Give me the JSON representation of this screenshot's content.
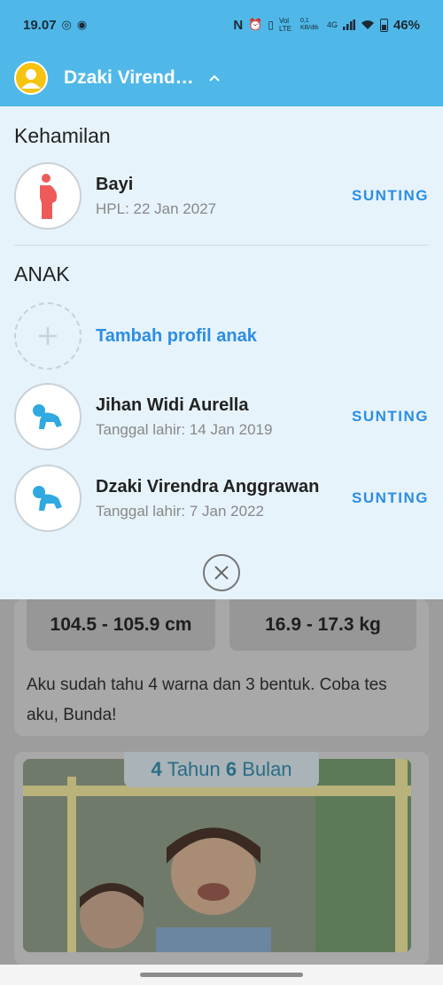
{
  "status_bar": {
    "time": "19.07",
    "network": "Vol LTE",
    "speed": "0,1 KB/dtk",
    "signal": "4G",
    "battery": "46%"
  },
  "header": {
    "child_name": "Dzaki Virend…"
  },
  "pregnancy": {
    "section_title": "Kehamilan",
    "name": "Bayi",
    "due_date": "HPL: 22 Jan 2027",
    "edit_label": "SUNTING"
  },
  "children": {
    "section_title": "ANAK",
    "add_label": "Tambah profil anak",
    "items": [
      {
        "name": "Jihan Widi Aurella",
        "birth": "Tanggal lahir: 14 Jan 2019",
        "edit_label": "SUNTING"
      },
      {
        "name": "Dzaki Virendra Anggrawan",
        "birth": "Tanggal lahir: 7 Jan 2022",
        "edit_label": "SUNTING"
      }
    ]
  },
  "background": {
    "height_range": "104.5 - 105.9 cm",
    "weight_range": "16.9 - 17.3 kg",
    "milestone_text": "Aku sudah tahu 4 warna dan 3 bentuk. Coba tes aku, Bunda!",
    "age_number_1": "4",
    "age_unit_1": "Tahun",
    "age_number_2": "6",
    "age_unit_2": "Bulan"
  },
  "colors": {
    "header": "#4fb8e8",
    "accent": "#2b8ee3",
    "panel": "#e7f3fb",
    "avatar": "#f6c30f"
  }
}
